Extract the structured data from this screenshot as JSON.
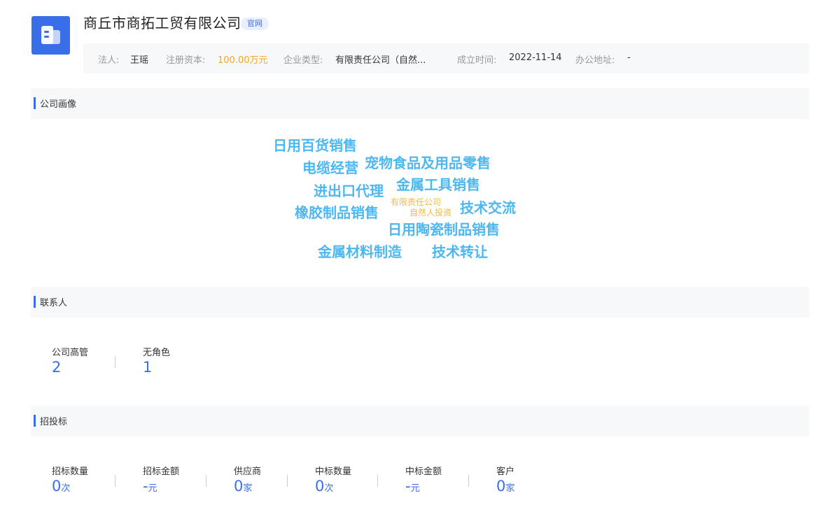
{
  "header": {
    "company_name": "商丘市商拓工贸有限公司",
    "tag_label": "官网",
    "info": {
      "legal_label": "法人:",
      "legal_value": "王瑶",
      "capital_label": "注册资本:",
      "capital_value": "100.00万元",
      "type_label": "企业类型:",
      "type_value": "有限责任公司（自然...",
      "founded_label": "成立时间:",
      "founded_value": "2022-11-14",
      "address_label": "办公地址:",
      "address_value": "-"
    }
  },
  "sections": {
    "profile_title": "公司画像",
    "contacts_title": "联系人",
    "bidding_title": "招投标"
  },
  "word_cloud": {
    "words": [
      "日用百货销售",
      "电缆经营",
      "宠物食品及用品零售",
      "进出口代理",
      "金属工具销售",
      "橡胶制品销售",
      "有限责任公司",
      "自然人投资",
      "技术交流",
      "日用陶瓷制品销售",
      "金属材料制造",
      "技术转让"
    ]
  },
  "contacts": {
    "stats": [
      {
        "label": "公司高管",
        "value": "2"
      },
      {
        "label": "无角色",
        "value": "1"
      }
    ]
  },
  "bidding": {
    "stats": [
      {
        "label": "招标数量",
        "value": "0",
        "unit": "次"
      },
      {
        "label": "招标金额",
        "value": "-",
        "unit": "元"
      },
      {
        "label": "供应商",
        "value": "0",
        "unit": "家"
      },
      {
        "label": "中标数量",
        "value": "0",
        "unit": "次"
      },
      {
        "label": "中标金额",
        "value": "-",
        "unit": "元"
      },
      {
        "label": "客户",
        "value": "0",
        "unit": "家"
      }
    ]
  },
  "colors": {
    "accent": "#3a6ee8",
    "money": "#f5a623",
    "cloud_word": "#4db8f0",
    "cloud_word_small": "#f5b942"
  },
  "icons": {
    "company_logo": "building-icon"
  }
}
